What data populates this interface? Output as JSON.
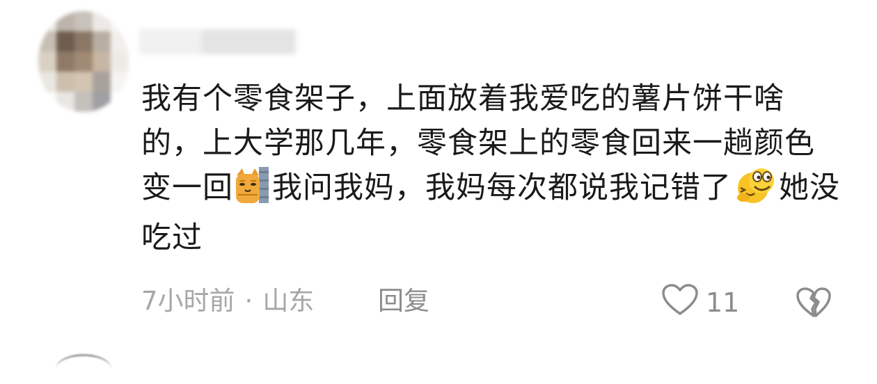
{
  "comment": {
    "part1": "我有个零食架子，上面放着我爱吃的薯片饼干啥的，上大学那几年，零食架上的零食回来一趟颜色变一回",
    "part2": "我问我妈，我妈每次都说我记错了",
    "part3": "她没吃过",
    "emojis": [
      "cat-peeking-wall-emoji",
      "awkward-laughing-emoji"
    ]
  },
  "footer": {
    "time": "7小时前",
    "separator": "·",
    "location": "山东",
    "reply_label": "回复",
    "like_count": "11"
  },
  "colors": {
    "text": "#1a1a1a",
    "meta": "#a6a6a6",
    "icon": "#8c8c8c"
  }
}
